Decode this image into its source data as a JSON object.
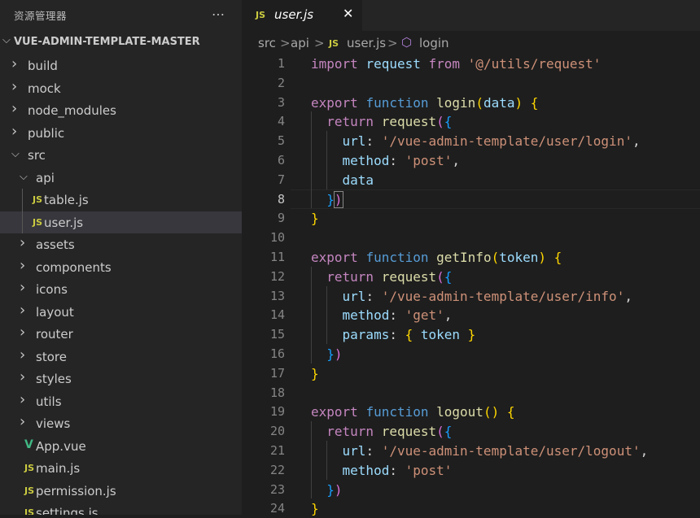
{
  "sidebar": {
    "title": "资源管理器",
    "more_icon": "…",
    "section_label": "VUE-ADMIN-TEMPLATE-MASTER",
    "tree": [
      {
        "name": "build",
        "kind": "folder",
        "depth": 0,
        "open": false
      },
      {
        "name": "mock",
        "kind": "folder",
        "depth": 0,
        "open": false
      },
      {
        "name": "node_modules",
        "kind": "folder",
        "depth": 0,
        "open": false
      },
      {
        "name": "public",
        "kind": "folder",
        "depth": 0,
        "open": false
      },
      {
        "name": "src",
        "kind": "folder",
        "depth": 0,
        "open": true
      },
      {
        "name": "api",
        "kind": "folder",
        "depth": 1,
        "open": true
      },
      {
        "name": "table.js",
        "kind": "js",
        "depth": 2
      },
      {
        "name": "user.js",
        "kind": "js",
        "depth": 2,
        "selected": true
      },
      {
        "name": "assets",
        "kind": "folder",
        "depth": 1,
        "open": false
      },
      {
        "name": "components",
        "kind": "folder",
        "depth": 1,
        "open": false
      },
      {
        "name": "icons",
        "kind": "folder",
        "depth": 1,
        "open": false
      },
      {
        "name": "layout",
        "kind": "folder",
        "depth": 1,
        "open": false
      },
      {
        "name": "router",
        "kind": "folder",
        "depth": 1,
        "open": false
      },
      {
        "name": "store",
        "kind": "folder",
        "depth": 1,
        "open": false
      },
      {
        "name": "styles",
        "kind": "folder",
        "depth": 1,
        "open": false
      },
      {
        "name": "utils",
        "kind": "folder",
        "depth": 1,
        "open": false
      },
      {
        "name": "views",
        "kind": "folder",
        "depth": 1,
        "open": false
      },
      {
        "name": "App.vue",
        "kind": "vue",
        "depth": 1
      },
      {
        "name": "main.js",
        "kind": "js",
        "depth": 1
      },
      {
        "name": "permission.js",
        "kind": "js",
        "depth": 1
      },
      {
        "name": "settings.js",
        "kind": "js",
        "depth": 1
      }
    ]
  },
  "tab": {
    "icon": "JS",
    "label": "user.js",
    "close": "✕"
  },
  "breadcrumb": {
    "parts": [
      "src",
      "api",
      "user.js",
      "login"
    ],
    "separator": ">",
    "js_icon": "JS"
  },
  "editor": {
    "active_line": 8,
    "lines": [
      [
        {
          "t": "import ",
          "c": "kw"
        },
        {
          "t": "request ",
          "c": "var"
        },
        {
          "t": "from ",
          "c": "kw"
        },
        {
          "t": "'@/utils/request'",
          "c": "str"
        }
      ],
      [],
      [
        {
          "t": "export ",
          "c": "kw"
        },
        {
          "t": "function ",
          "c": "st"
        },
        {
          "t": "login",
          "c": "fn"
        },
        {
          "t": "(",
          "c": "b1"
        },
        {
          "t": "data",
          "c": "var"
        },
        {
          "t": ") ",
          "c": "b1"
        },
        {
          "t": "{",
          "c": "b1"
        }
      ],
      [
        {
          "t": "  "
        },
        {
          "t": "return ",
          "c": "kw"
        },
        {
          "t": "request",
          "c": "fn"
        },
        {
          "t": "(",
          "c": "b2"
        },
        {
          "t": "{",
          "c": "b3"
        }
      ],
      [
        {
          "t": "    "
        },
        {
          "t": "url",
          "c": "var"
        },
        {
          "t": ": "
        },
        {
          "t": "'/vue-admin-template/user/login'",
          "c": "str"
        },
        {
          "t": ","
        }
      ],
      [
        {
          "t": "    "
        },
        {
          "t": "method",
          "c": "var"
        },
        {
          "t": ": "
        },
        {
          "t": "'post'",
          "c": "str"
        },
        {
          "t": ","
        }
      ],
      [
        {
          "t": "    "
        },
        {
          "t": "data",
          "c": "var"
        }
      ],
      [
        {
          "t": "  "
        },
        {
          "t": "}",
          "c": "b3"
        },
        {
          "t": ")",
          "c": "b2",
          "m": true
        }
      ],
      [
        {
          "t": "}",
          "c": "b1"
        }
      ],
      [],
      [
        {
          "t": "export ",
          "c": "kw"
        },
        {
          "t": "function ",
          "c": "st"
        },
        {
          "t": "getInfo",
          "c": "fn"
        },
        {
          "t": "(",
          "c": "b1"
        },
        {
          "t": "token",
          "c": "var"
        },
        {
          "t": ") ",
          "c": "b1"
        },
        {
          "t": "{",
          "c": "b1"
        }
      ],
      [
        {
          "t": "  "
        },
        {
          "t": "return ",
          "c": "kw"
        },
        {
          "t": "request",
          "c": "fn"
        },
        {
          "t": "(",
          "c": "b2"
        },
        {
          "t": "{",
          "c": "b3"
        }
      ],
      [
        {
          "t": "    "
        },
        {
          "t": "url",
          "c": "var"
        },
        {
          "t": ": "
        },
        {
          "t": "'/vue-admin-template/user/info'",
          "c": "str"
        },
        {
          "t": ","
        }
      ],
      [
        {
          "t": "    "
        },
        {
          "t": "method",
          "c": "var"
        },
        {
          "t": ": "
        },
        {
          "t": "'get'",
          "c": "str"
        },
        {
          "t": ","
        }
      ],
      [
        {
          "t": "    "
        },
        {
          "t": "params",
          "c": "var"
        },
        {
          "t": ": "
        },
        {
          "t": "{ ",
          "c": "b1"
        },
        {
          "t": "token",
          "c": "var"
        },
        {
          "t": " }",
          "c": "b1"
        }
      ],
      [
        {
          "t": "  "
        },
        {
          "t": "}",
          "c": "b3"
        },
        {
          "t": ")",
          "c": "b2"
        }
      ],
      [
        {
          "t": "}",
          "c": "b1"
        }
      ],
      [],
      [
        {
          "t": "export ",
          "c": "kw"
        },
        {
          "t": "function ",
          "c": "st"
        },
        {
          "t": "logout",
          "c": "fn"
        },
        {
          "t": "() ",
          "c": "b1"
        },
        {
          "t": "{",
          "c": "b1"
        }
      ],
      [
        {
          "t": "  "
        },
        {
          "t": "return ",
          "c": "kw"
        },
        {
          "t": "request",
          "c": "fn"
        },
        {
          "t": "(",
          "c": "b2"
        },
        {
          "t": "{",
          "c": "b3"
        }
      ],
      [
        {
          "t": "    "
        },
        {
          "t": "url",
          "c": "var"
        },
        {
          "t": ": "
        },
        {
          "t": "'/vue-admin-template/user/logout'",
          "c": "str"
        },
        {
          "t": ","
        }
      ],
      [
        {
          "t": "    "
        },
        {
          "t": "method",
          "c": "var"
        },
        {
          "t": ": "
        },
        {
          "t": "'post'",
          "c": "str"
        }
      ],
      [
        {
          "t": "  "
        },
        {
          "t": "}",
          "c": "b3"
        },
        {
          "t": ")",
          "c": "b2"
        }
      ],
      [
        {
          "t": "}",
          "c": "b1"
        }
      ]
    ]
  }
}
